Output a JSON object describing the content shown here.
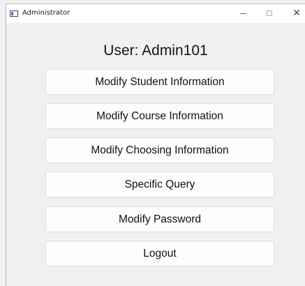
{
  "window": {
    "title": "Administrator",
    "minimize_glyph": "—",
    "close_glyph": "✕"
  },
  "heading": "User: Admin101",
  "buttons": {
    "modify_student": "Modify Student Information",
    "modify_course": "Modify Course Information",
    "modify_choosing": "Modify Choosing Information",
    "specific_query": "Specific Query",
    "modify_password": "Modify Password",
    "logout": "Logout"
  },
  "icons": {
    "app": "window-app-icon",
    "minimize": "minimize-icon",
    "maximize": "maximize-icon",
    "close": "close-icon"
  },
  "colors": {
    "background": "#f0f0f0",
    "titlebar": "#ffffff",
    "button_bg": "#fdfdfd",
    "button_border": "#dedede",
    "text": "#111111"
  }
}
